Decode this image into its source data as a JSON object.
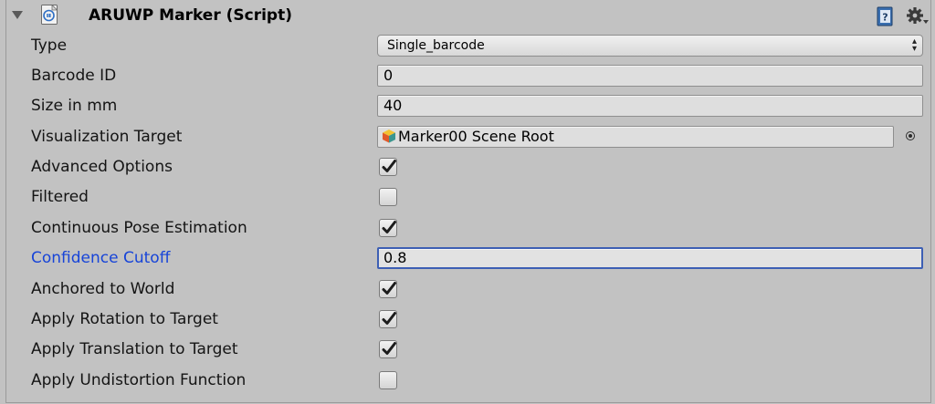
{
  "header": {
    "title": "ARUWP Marker (Script)",
    "enabled": true
  },
  "fields": {
    "type": {
      "label": "Type",
      "value": "Single_barcode",
      "arrow": "▴▾"
    },
    "barcode_id": {
      "label": "Barcode ID",
      "value": "0"
    },
    "size_in_mm": {
      "label": "Size in mm",
      "value": "40"
    },
    "visualization_target": {
      "label": "Visualization Target",
      "value": "Marker00 Scene Root"
    },
    "advanced_options": {
      "label": "Advanced Options",
      "checked": true
    },
    "filtered": {
      "label": "Filtered",
      "checked": false
    },
    "continuous_pose_estimation": {
      "label": "Continuous Pose Estimation",
      "checked": true
    },
    "confidence_cutoff": {
      "label": "Confidence Cutoff",
      "value": "0.8"
    },
    "anchored_to_world": {
      "label": "Anchored to World",
      "checked": true
    },
    "apply_rotation_to_target": {
      "label": "Apply Rotation to Target",
      "checked": true
    },
    "apply_translation_to_target": {
      "label": "Apply Translation to Target",
      "checked": true
    },
    "apply_undistortion_function": {
      "label": "Apply Undistortion Function",
      "checked": false
    }
  },
  "colors": {
    "panel_bg": "#c2c2c2",
    "active_label": "#1744d8",
    "focus_border": "#3d5fb4",
    "checkmark": "#1c1c1c"
  },
  "icons": {
    "script": "csharp-script-icon",
    "help": "help-book-icon",
    "settings": "gear-icon",
    "target_object": "gameobject-cube-icon",
    "object_picker": "object-picker-icon"
  }
}
